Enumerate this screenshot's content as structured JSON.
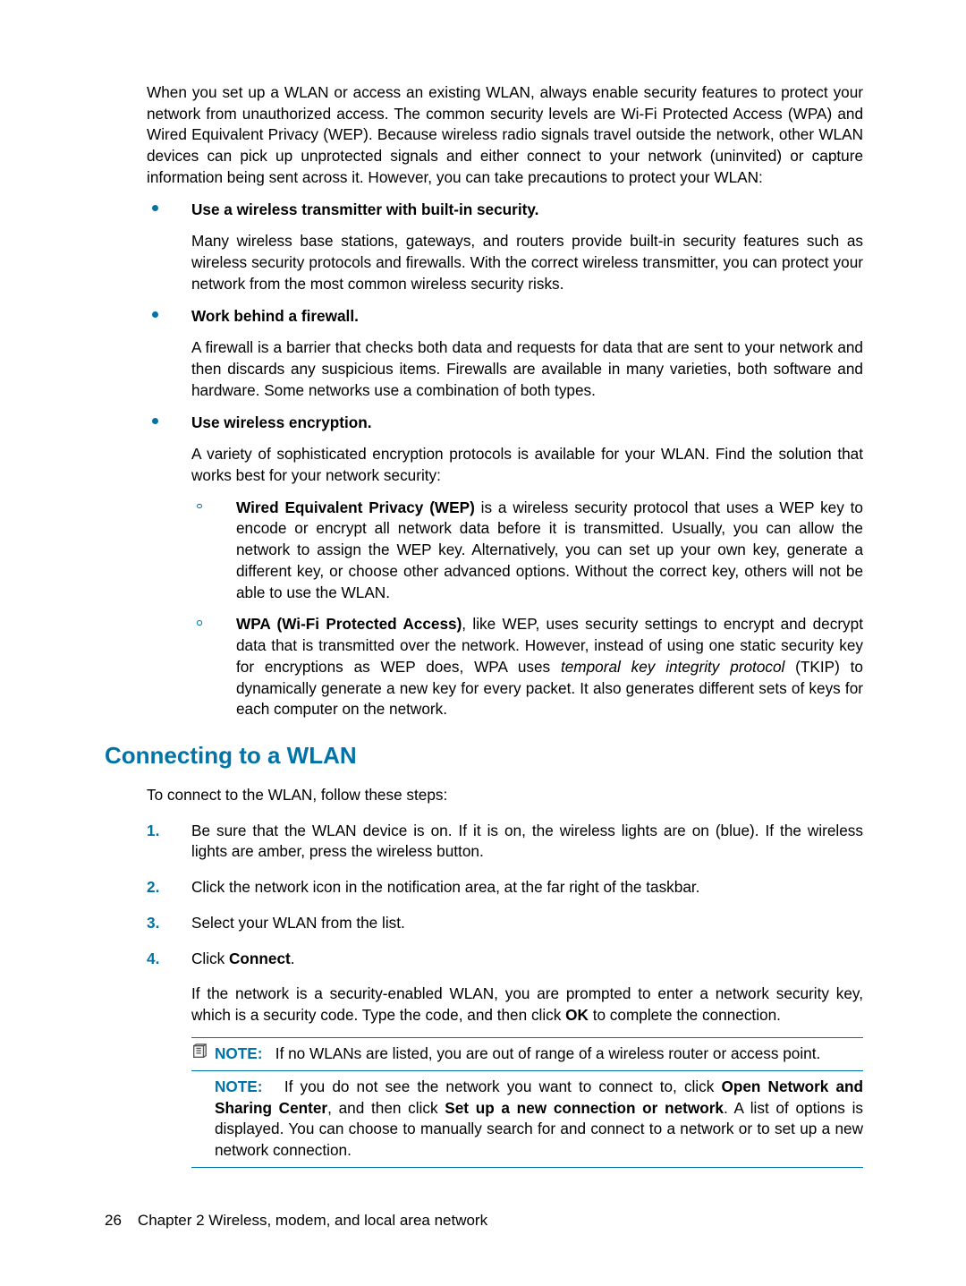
{
  "intro": "When you set up a WLAN or access an existing WLAN, always enable security features to protect your network from unauthorized access. The common security levels are Wi-Fi Protected Access (WPA) and Wired Equivalent Privacy (WEP). Because wireless radio signals travel outside the network, other WLAN devices can pick up unprotected signals and either connect to your network (uninvited) or capture information being sent across it. However, you can take precautions to protect your WLAN:",
  "bullets": {
    "b1": {
      "heading": "Use a wireless transmitter with built-in security",
      "body": "Many wireless base stations, gateways, and routers provide built-in security features such as wireless security protocols and firewalls. With the correct wireless transmitter, you can protect your network from the most common wireless security risks."
    },
    "b2": {
      "heading": "Work behind a firewall",
      "body": "A firewall is a barrier that checks both data and requests for data that are sent to your network and then discards any suspicious items. Firewalls are available in many varieties, both software and hardware. Some networks use a combination of both types."
    },
    "b3": {
      "heading": "Use wireless encryption",
      "body": "A variety of sophisticated encryption protocols is available for your WLAN. Find the solution that works best for your network security:",
      "sub": {
        "s1": {
          "lead": "Wired Equivalent Privacy (WEP)",
          "rest": " is a wireless security protocol that uses a WEP key to encode or encrypt all network data before it is transmitted. Usually, you can allow the network to assign the WEP key. Alternatively, you can set up your own key, generate a different key, or choose other advanced options. Without the correct key, others will not be able to use the WLAN."
        },
        "s2": {
          "lead": "WPA (Wi-Fi Protected Access)",
          "rest1": ", like WEP, uses security settings to encrypt and decrypt data that is transmitted over the network. However, instead of using one static security key for encryptions as WEP does, WPA uses ",
          "em": "temporal key integrity protocol",
          "rest2": " (TKIP) to dynamically generate a new key for every packet. It also generates different sets of keys for each computer on the network."
        }
      }
    }
  },
  "section_heading": "Connecting to a WLAN",
  "section_intro": "To connect to the WLAN, follow these steps:",
  "steps": {
    "s1": "Be sure that the WLAN device is on. If it is on, the wireless lights are on (blue). If the wireless lights are amber, press the wireless button.",
    "s2": "Click the network icon in the notification area, at the far right of the taskbar.",
    "s3": "Select your WLAN from the list.",
    "s4_pre": "Click ",
    "s4_b": "Connect",
    "s4_post": ".",
    "s4_sub_pre": "If the network is a security-enabled WLAN, you are prompted to enter a network security key, which is a security code. Type the code, and then click ",
    "s4_sub_b": "OK",
    "s4_sub_post": " to complete the connection."
  },
  "note": {
    "label": "NOTE:",
    "n1": "If no WLANs are listed, you are out of range of a wireless router or access point.",
    "n2_pre": "If you do not see the network you want to connect to, click ",
    "n2_b1": "Open Network and Sharing Center",
    "n2_mid": ", and then click ",
    "n2_b2": "Set up a new connection or network",
    "n2_post": ". A list of options is displayed. You can choose to manually search for and connect to a network or to set up a new network connection."
  },
  "footer": {
    "page": "26",
    "chapter": "Chapter 2   Wireless, modem, and local area network"
  }
}
